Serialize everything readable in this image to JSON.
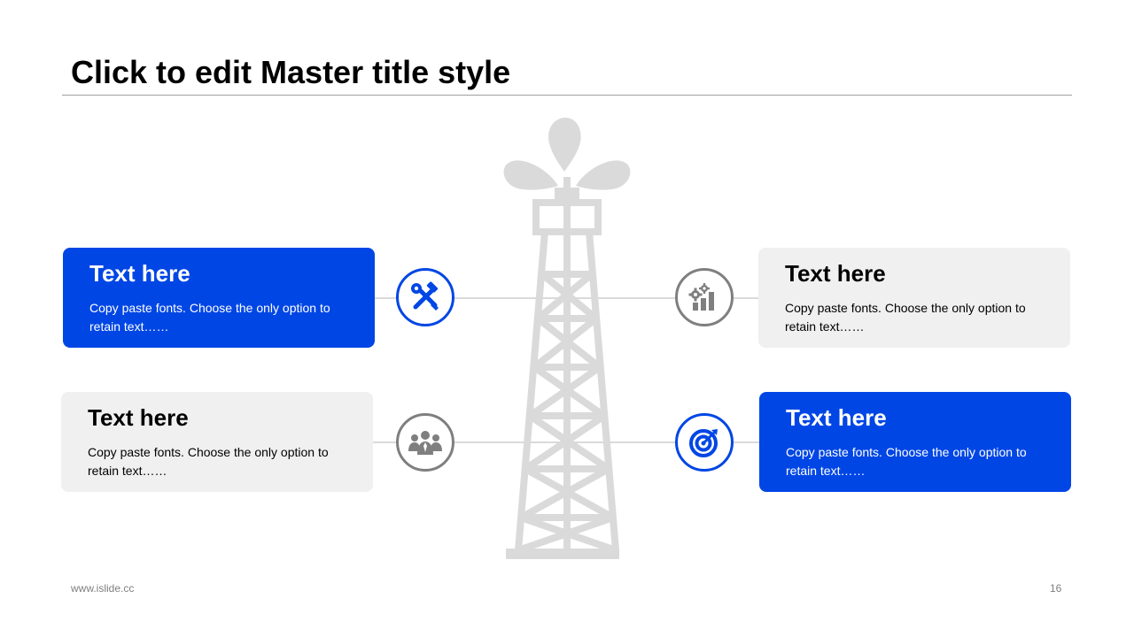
{
  "title": "Click to edit Master title style",
  "colors": {
    "accent": "#0046e5",
    "card_gray": "#f0f0f0",
    "tower": "#dadada",
    "icon_gray": "#7f7f7f"
  },
  "cards": [
    {
      "title": "Text here",
      "body": "Copy paste fonts. Choose the only option to retain text……",
      "style": "blue",
      "icon": "tools-icon"
    },
    {
      "title": "Text here",
      "body": "Copy paste fonts. Choose the only option to retain text……",
      "style": "gray",
      "icon": "gear-chart-icon"
    },
    {
      "title": "Text here",
      "body": "Copy paste fonts. Choose the only option to retain text……",
      "style": "gray",
      "icon": "team-icon"
    },
    {
      "title": "Text here",
      "body": "Copy paste fonts. Choose the only option to retain text……",
      "style": "blue",
      "icon": "target-icon"
    }
  ],
  "tower_icon": "oil-derrick-icon",
  "footer": {
    "website": "www.islide.cc",
    "page_number": "16"
  }
}
